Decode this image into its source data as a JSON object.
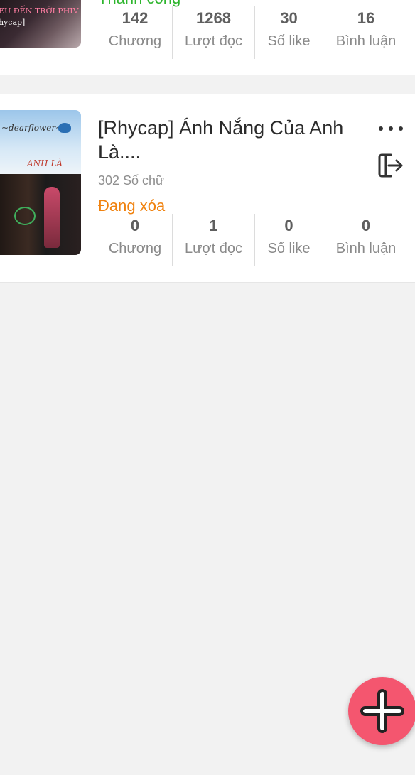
{
  "stories": [
    {
      "status": "Thành công",
      "status_color": "#2db52d",
      "cover_text_line1": "EU ĐẾN TRỜI PHIV",
      "cover_text_line2": "hycap]",
      "stats": [
        {
          "value": "142",
          "label": "Chương"
        },
        {
          "value": "1268",
          "label": "Lượt đọc"
        },
        {
          "value": "30",
          "label": "Số like"
        },
        {
          "value": "16",
          "label": "Bình luận"
        }
      ]
    },
    {
      "title": "[Rhycap] Ánh Nắng Của Anh Là....",
      "word_count": "302 Số chữ",
      "status": "Đang xóa",
      "status_color": "#f0820f",
      "cover_text_top": "~dearflower~",
      "cover_text_mid": "ANH LÀ",
      "stats": [
        {
          "value": "0",
          "label": "Chương"
        },
        {
          "value": "1",
          "label": "Lượt đọc"
        },
        {
          "value": "0",
          "label": "Số like"
        },
        {
          "value": "0",
          "label": "Bình luận"
        }
      ]
    }
  ],
  "icons": {
    "more": "more-dots-icon",
    "exit": "exit-icon",
    "add": "plus-icon"
  },
  "colors": {
    "fab": "#f4566f",
    "background": "#f2f2f2"
  }
}
